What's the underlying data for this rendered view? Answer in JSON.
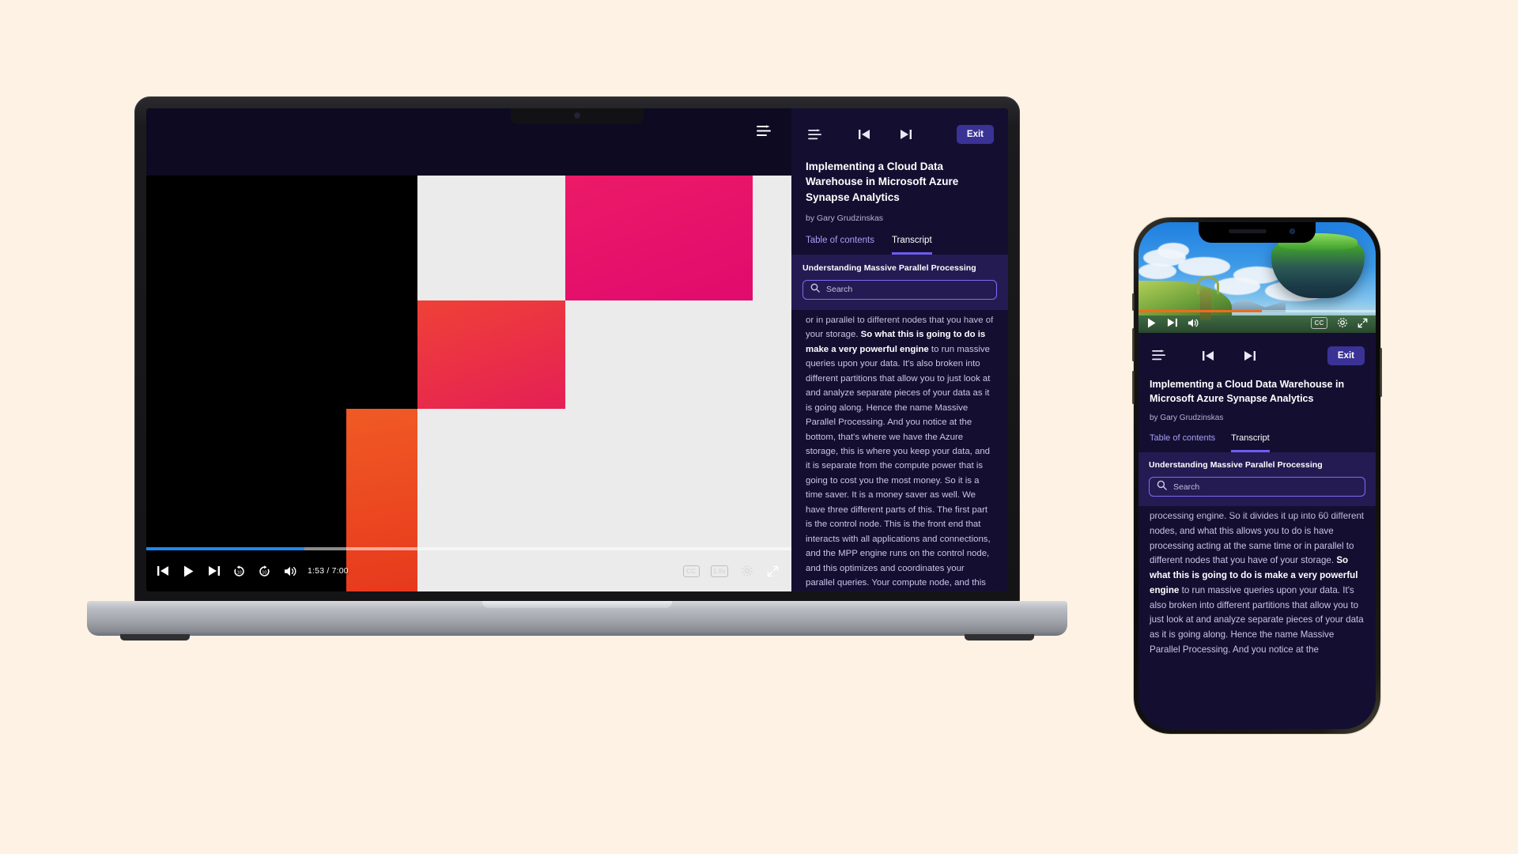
{
  "course": {
    "title": "Implementing a Cloud Data Warehouse in Microsoft Azure Synapse Analytics",
    "title_laptop": "Implementing a Cloud Data Warehouse in Microsoft Azure Synapse Analytics",
    "author": "by Gary Grudzinskas",
    "exit_label": "Exit",
    "tabs": [
      {
        "label": "Table of contents",
        "active": false
      },
      {
        "label": "Transcript",
        "active": true
      }
    ],
    "chapter": "Understanding Massive Parallel Processing",
    "search_placeholder": "Search",
    "search_value": ""
  },
  "player": {
    "time_current": "1:53",
    "time_total": "7:00",
    "time_display": "1:53 / 7:00",
    "progress_percent": 25,
    "cc_label": "CC",
    "speed_label": "1.9x",
    "icons": {
      "queue": "playlist-queue-icon",
      "previous": "previous-track-icon",
      "play": "play-icon",
      "next": "next-track-icon",
      "rewind": "rewind-10-icon",
      "forward": "forward-10-icon",
      "volume": "volume-icon",
      "cc": "closed-captions-icon",
      "speed": "playback-speed-icon",
      "settings": "gear-icon",
      "fullscreen": "fullscreen-icon"
    }
  },
  "transcript": {
    "laptop": [
      {
        "text": "or in parallel to different nodes that you have of your storage. ",
        "bold": false
      },
      {
        "text": "So what this is going to do is make a very powerful engine",
        "bold": true
      },
      {
        "text": " to run massive queries upon your data. It's also broken into different partitions that allow you to just look at and analyze separate pieces of your data as it is going along. Hence the name Massive Parallel Processing. And you notice at the bottom, that's where we have the Azure storage, this is where you keep your data, and it is separate from the compute power that is going to cost you the most money. So it is a time saver. It is a money saver as well. We have three different parts of this. The first part is the control node. This is the front end that interacts with all applications and connections, and the MPP engine runs on the control node, and this optimizes and coordinates your parallel queries. Your compute node, and this provides a computational power for",
        "bold": false
      }
    ],
    "phone": [
      {
        "text": "processing engine. So it divides it up into 60 different nodes, and what this allows you to do is have processing acting at the same time or in parallel to different nodes that you have of your storage. ",
        "bold": false
      },
      {
        "text": "So what this is going to do is make a very powerful engine",
        "bold": true
      },
      {
        "text": " to run massive queries upon your data. It's also broken into different partitions that allow you to just look at and analyze separate pieces of your data as it is going along. Hence the name Massive Parallel Processing. And you notice at the",
        "bold": false
      }
    ]
  },
  "colors": {
    "page_background": "#fdf2e4",
    "panel_background": "#140f31",
    "search_panel_background": "#241b52",
    "accent_purple": "#6d5df0",
    "exit_button": "#3b3296",
    "link_purple": "#a79ef5",
    "scrub_blue": "#1e87ef",
    "scrub_orange": "#f06a20",
    "video_pink": "#e10a6e",
    "video_red": "#e51f56",
    "video_orange": "#f05a24"
  }
}
